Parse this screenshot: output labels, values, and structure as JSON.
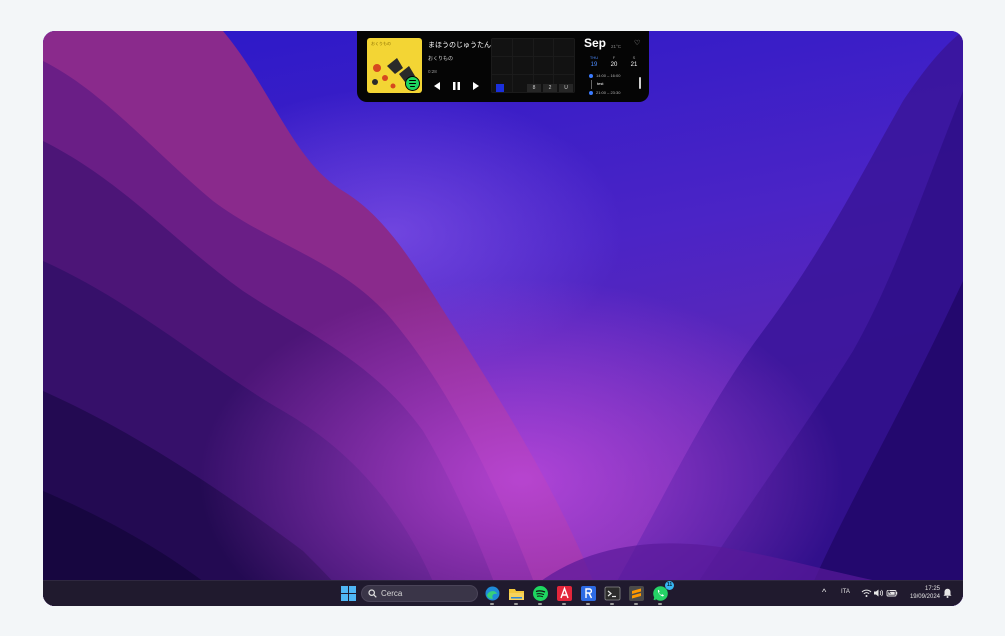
{
  "now_playing": {
    "title": "まほうのじゅうたん",
    "artist": "おくりもの",
    "elapsed": "0:28",
    "cover_text": "おくりもの"
  },
  "tiles": {
    "labels": [
      "8",
      "2",
      "U"
    ]
  },
  "calendar": {
    "month": "Sep",
    "temperature": "21°C",
    "days": [
      {
        "name": "THU",
        "date": "19",
        "today": true
      },
      {
        "name": "F",
        "date": "20",
        "today": false
      },
      {
        "name": "S",
        "date": "21",
        "today": false
      }
    ],
    "events": [
      {
        "time": "14:00 – 16:00",
        "name": "test"
      },
      {
        "time": "21:00 – 23:30",
        "name": ""
      }
    ]
  },
  "taskbar": {
    "search_placeholder": "Cerca",
    "apps": [
      "edge-icon",
      "file-explorer-icon",
      "spotify-icon",
      "acrobat-icon",
      "r-app-icon",
      "terminal-icon",
      "sublime-text-icon",
      "whatsapp-icon"
    ],
    "whatsapp_badge": "11",
    "language": "ITA",
    "time": "17:25",
    "date": "19/09/2024"
  },
  "colors": {
    "accent": "#3a7bff",
    "spotify": "#1ed760",
    "taskbar": "#201a2e"
  }
}
